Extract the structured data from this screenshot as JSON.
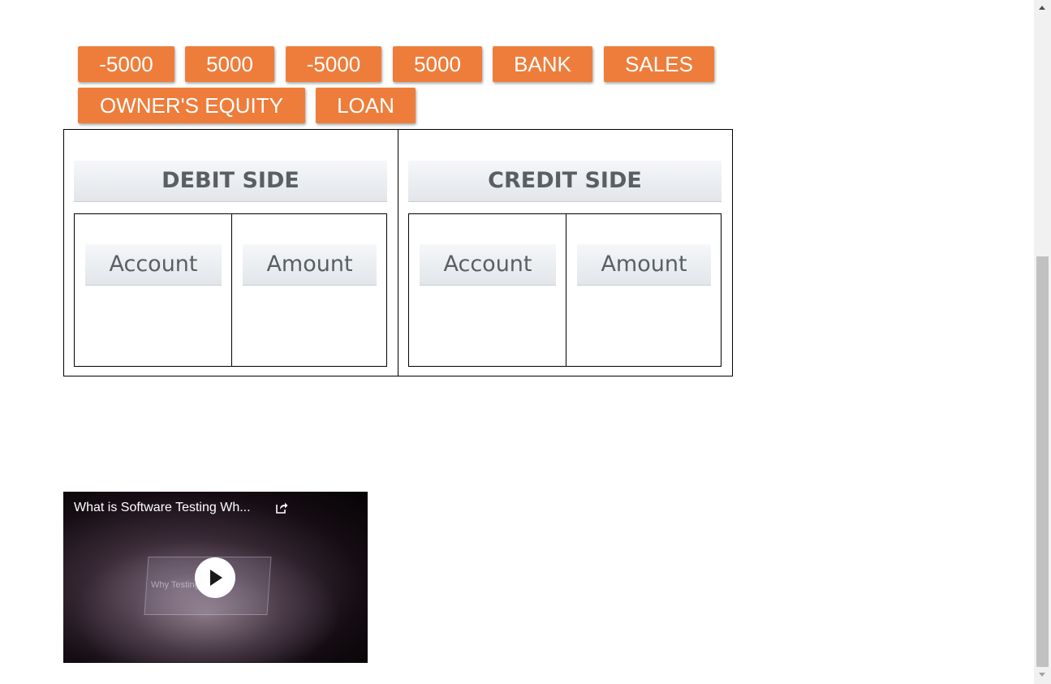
{
  "buttons": {
    "b1": "-5000",
    "b2": "5000",
    "b3": "-5000",
    "b4": "5000",
    "b5": "BANK",
    "b6": "SALES",
    "b7": "OWNER'S EQUITY",
    "b8": "LOAN"
  },
  "ledger": {
    "debit": {
      "header": "DEBIT SIDE",
      "account_label": "Account",
      "amount_label": "Amount"
    },
    "credit": {
      "header": "CREDIT SIDE",
      "account_label": "Account",
      "amount_label": "Amount"
    }
  },
  "video": {
    "title": "What is Software Testing Wh...",
    "thumbnail_text": "Why Testing           rtant ?"
  },
  "colors": {
    "button_bg": "#ee7d3b",
    "header_text": "#5a5f63"
  },
  "icons": {
    "share": "share-icon",
    "play": "play-icon",
    "scroll_up": "scroll-up-arrow-icon",
    "scroll_down": "scroll-down-arrow-icon"
  }
}
